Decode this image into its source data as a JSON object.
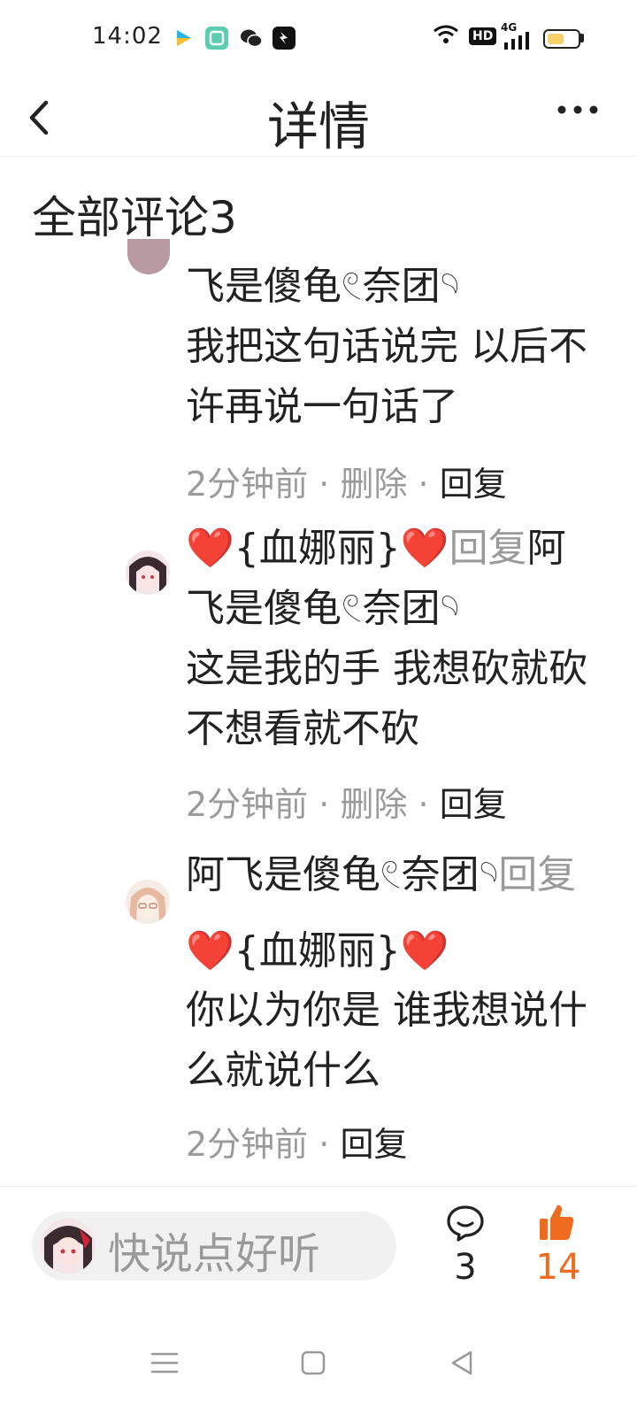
{
  "status_bar": {
    "time": "14:02",
    "hd_label": "HD",
    "network_label": "4G",
    "icons": [
      "video-app-icon",
      "gallery-app-icon",
      "wechat-icon",
      "messenger-app-icon",
      "wifi-icon",
      "hd-icon",
      "signal-icon",
      "battery-icon"
    ]
  },
  "header": {
    "back_icon": "chevron-left-icon",
    "title": "详情",
    "more_icon": "more-dots-icon"
  },
  "comments_section": {
    "title": "全部评论3",
    "comments": [
      {
        "line_partial": "飞是傻龟𓏲奈团𓄹",
        "text": "我把这句话说完 以后不许再说一句话了",
        "time": "2分钟前",
        "delete_label": "删除",
        "reply_label": "回复"
      },
      {
        "author": "❤️{血娜丽}❤️",
        "reply_word": "回复",
        "reply_to": "阿飞是傻龟𓏲奈团𓄹",
        "text": "这是我的手 我想砍就砍 不想看就不砍",
        "time": "2分钟前",
        "delete_label": "删除",
        "reply_label": "回复"
      },
      {
        "author": "阿飞是傻龟𓏲奈团𓄹",
        "reply_word": "回复",
        "reply_to": "❤️{血娜丽}❤️",
        "text": "你以为你是 谁我想说什么就说什么",
        "time": "2分钟前",
        "reply_label": "回复"
      }
    ]
  },
  "bottom_bar": {
    "input_placeholder": "快说点好听",
    "comment_count": "3",
    "like_count": "14",
    "accent_color": "#ef6b1f"
  },
  "nav_bar": {
    "icons": [
      "menu-icon",
      "home-square-icon",
      "back-triangle-icon"
    ]
  }
}
